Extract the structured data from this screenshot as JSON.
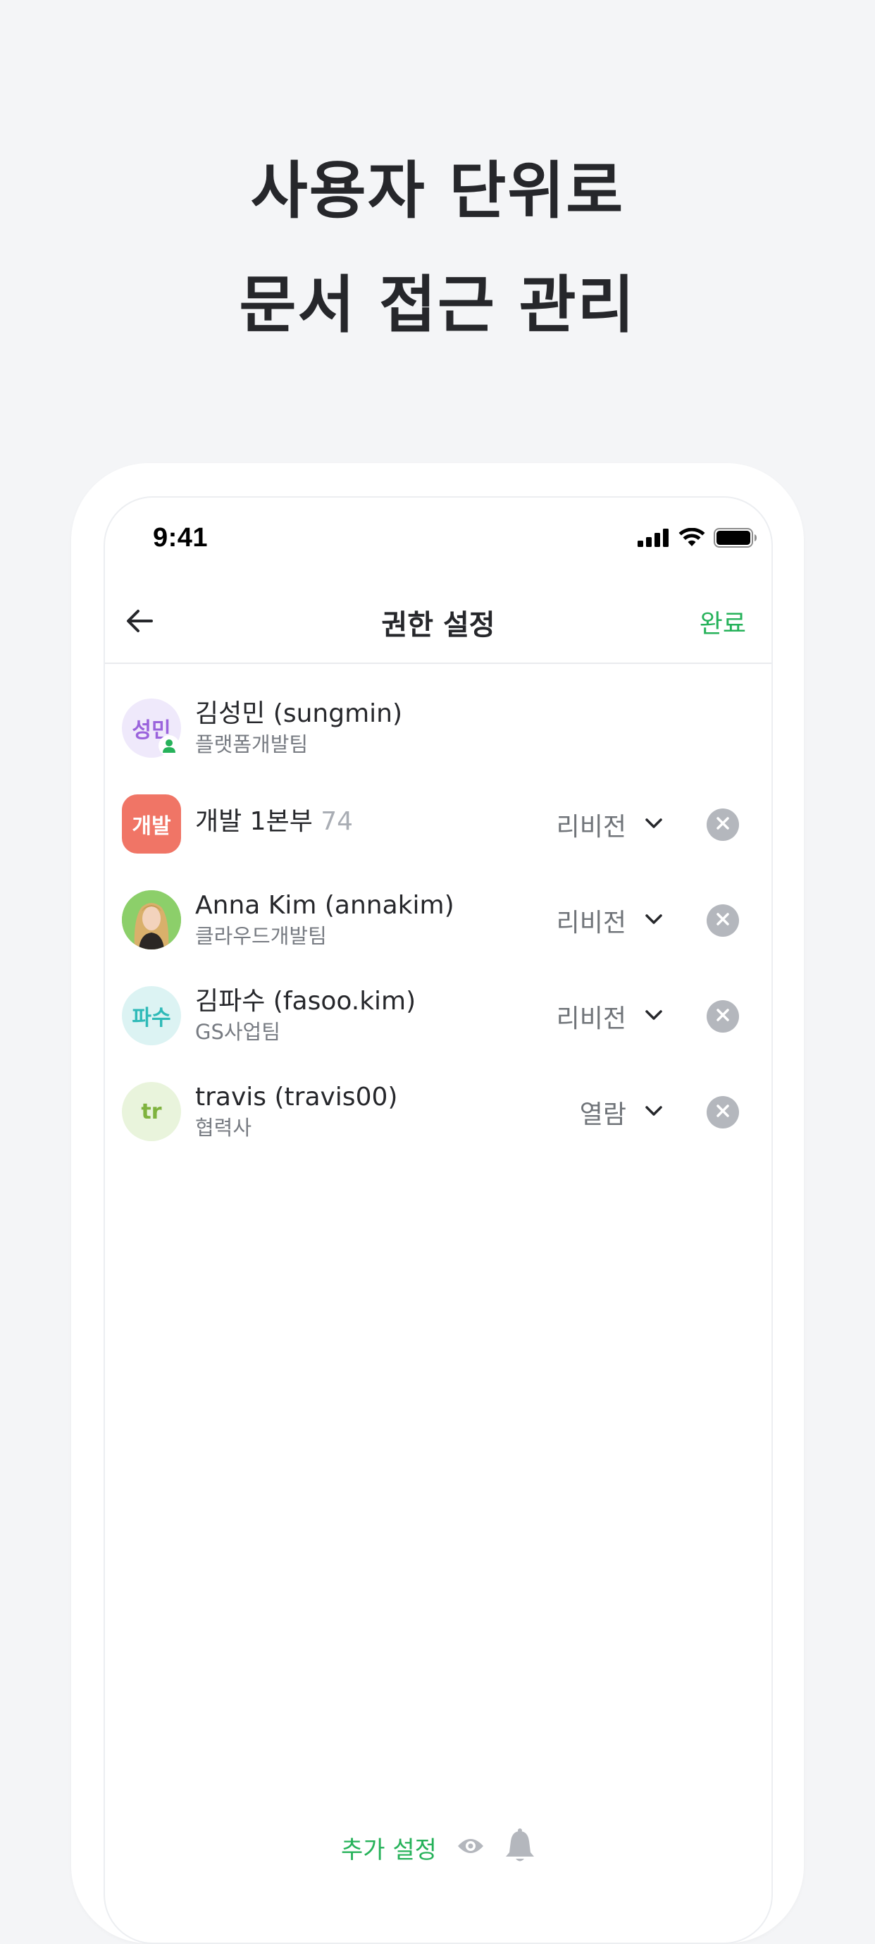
{
  "headline": {
    "line1": "사용자 단위로",
    "line2": "문서 접근 관리"
  },
  "status_bar": {
    "time": "9:41",
    "icons": [
      "signal-icon",
      "wifi-icon",
      "battery-icon"
    ]
  },
  "navbar": {
    "title": "권한 설정",
    "done_label": "완료",
    "back_icon": "arrow-left-icon"
  },
  "colors": {
    "accent": "#26b25a",
    "title": "#26272b",
    "muted": "#777b82"
  },
  "members": [
    {
      "avatar_text": "성민",
      "name": "김성민 (sungmin)",
      "count": "",
      "sub": "플랫폼개발팀",
      "permission": "",
      "is_owner": true
    },
    {
      "avatar_text": "개발",
      "name": "개발 1본부",
      "count": "74",
      "sub": "",
      "permission": "리비전"
    },
    {
      "avatar_text": "",
      "name": "Anna Kim  (annakim)",
      "count": "",
      "sub": "클라우드개발팀",
      "permission": "리비전"
    },
    {
      "avatar_text": "파수",
      "name": "김파수 (fasoo.kim)",
      "count": "",
      "sub": "GS사업팀",
      "permission": "리비전"
    },
    {
      "avatar_text": "tr",
      "name": "travis (travis00)",
      "count": "",
      "sub": "협력사",
      "permission": "열람"
    }
  ],
  "bottom_bar": {
    "extra_settings_label": "추가 설정",
    "icons": [
      "eye-icon",
      "bell-icon"
    ]
  }
}
